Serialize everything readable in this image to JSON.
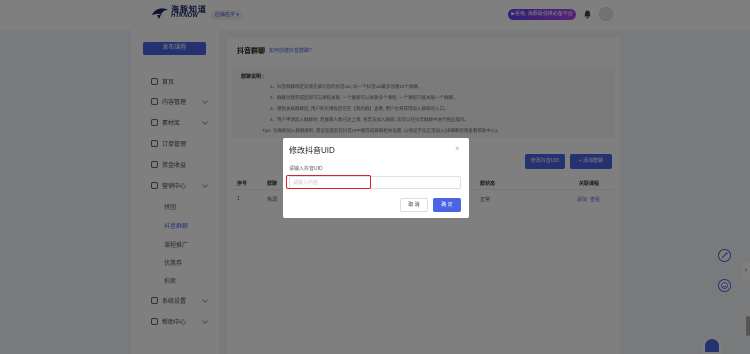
{
  "topbar": {
    "logo_cn": "海豚知道",
    "logo_en": "HTKNOW",
    "workspace": "店铺名字",
    "promo": "▶拒绝, 海豚最强推必备平台",
    "colors": {
      "accent": "#4a64e3",
      "brand": "#1e2a6b"
    }
  },
  "sidebar": {
    "publish": "发布课程",
    "items": [
      {
        "label": "首页",
        "icon": "home-icon"
      },
      {
        "label": "内容管理",
        "icon": "content-icon"
      },
      {
        "label": "素材库",
        "icon": "material-icon"
      },
      {
        "label": "订单管理",
        "icon": "order-icon"
      },
      {
        "label": "资金收益",
        "icon": "wallet-icon"
      },
      {
        "label": "营销中心",
        "icon": "marketing-icon"
      }
    ],
    "sub_items": [
      "拼团",
      "抖音群聊",
      "课程推广",
      "优惠券",
      "拍卖"
    ],
    "bottom_items": [
      {
        "label": "系统设置",
        "icon": "settings-icon"
      },
      {
        "label": "帮助中心",
        "icon": "help-icon"
      }
    ]
  },
  "main": {
    "title": "抖音群聊",
    "link": "如何创建抖音群聊?",
    "notice_title": "群聊说明 :",
    "notice_lines": [
      "1、抖音群聊绑定前请先填写您的抖音uid, 同一个抖音uid最多创建10个群聊。",
      "2、群聊创建完成后即可与课程关联, 一个群聊可以关联多个课程, 一个课程只能关联一个群聊。",
      "3、课程关联群聊后, 用户购买课程后可在【我的群】查看, 用户也将获得加入群聊的入口。",
      "4、用户申请加入群聊时, 若群聊人数已达上限, 将无法加入群聊, 您可以在抖音群聊中进行相应操作。",
      "Tips: 为确保加入群聊顺利, 建议您提前在抖音APP端完成群聊相关设置, 以保证学员正常加入(详细教程请查看帮助中心)。"
    ],
    "btn_uid": "修改抖音UID",
    "btn_add": "+ 添加群聊",
    "columns": [
      "序号",
      "群聊",
      "群状态",
      "关联课程"
    ],
    "row": {
      "index": "1",
      "name": "热调",
      "status": "正常",
      "action_add": "添加",
      "action_view": "查看"
    }
  },
  "modal": {
    "title": "修改抖音UID",
    "label": "请输入抖音UID",
    "placeholder": "请输入内容",
    "value": "",
    "cancel": "取 消",
    "confirm": "确 定"
  }
}
